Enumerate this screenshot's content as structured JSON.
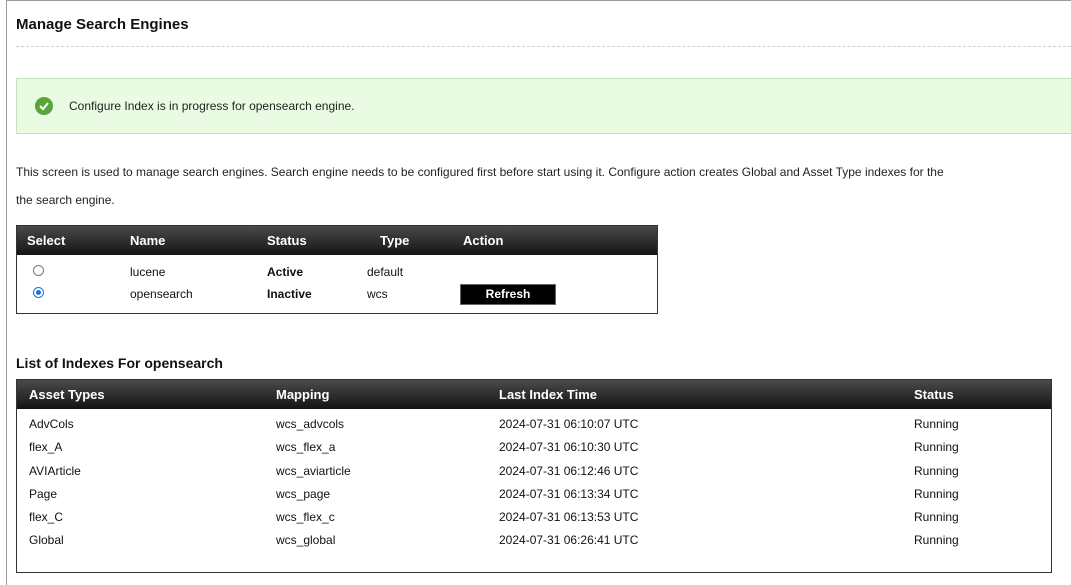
{
  "page": {
    "title": "Manage Search Engines"
  },
  "alert": {
    "icon": "check-circle-icon",
    "message": "Configure Index is in progress for opensearch engine."
  },
  "description": {
    "line1": "This screen is used to manage search engines. Search engine needs to be configured first before start using it. Configure action creates Global and Asset Type indexes for the",
    "line2": "the search engine."
  },
  "engines": {
    "headers": {
      "select": "Select",
      "name": "Name",
      "status": "Status",
      "type": "Type",
      "action": "Action"
    },
    "rows": [
      {
        "name": "lucene",
        "status": "Active",
        "type": "default",
        "selected": false,
        "action": ""
      },
      {
        "name": "opensearch",
        "status": "Inactive",
        "type": "wcs",
        "selected": true,
        "action": "Refresh"
      }
    ]
  },
  "indexes": {
    "title": "List of Indexes For opensearch",
    "headers": {
      "asset_types": "Asset Types",
      "mapping": "Mapping",
      "last_index_time": "Last Index Time",
      "status": "Status"
    },
    "rows": [
      {
        "asset_type": "AdvCols",
        "mapping": "wcs_advcols",
        "time": "2024-07-31 06:10:07 UTC",
        "status": "Running"
      },
      {
        "asset_type": "flex_A",
        "mapping": "wcs_flex_a",
        "time": "2024-07-31 06:10:30 UTC",
        "status": "Running"
      },
      {
        "asset_type": "AVIArticle",
        "mapping": "wcs_aviarticle",
        "time": "2024-07-31 06:12:46 UTC",
        "status": "Running"
      },
      {
        "asset_type": "Page",
        "mapping": "wcs_page",
        "time": "2024-07-31 06:13:34 UTC",
        "status": "Running"
      },
      {
        "asset_type": "flex_C",
        "mapping": "wcs_flex_c",
        "time": "2024-07-31 06:13:53 UTC",
        "status": "Running"
      },
      {
        "asset_type": "Global",
        "mapping": "wcs_global",
        "time": "2024-07-31 06:26:41 UTC",
        "status": "Running"
      }
    ]
  }
}
